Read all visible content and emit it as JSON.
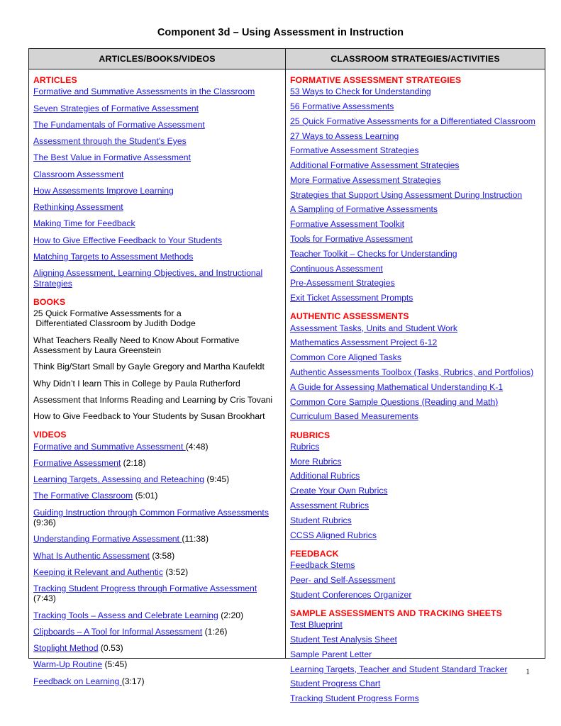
{
  "document": {
    "title": "Component 3d – Using Assessment in Instruction",
    "page_number": "1"
  },
  "colors": {
    "section_heading": "#FF0000",
    "link": "#1A14E6",
    "header_row_background": "#D4D4D4",
    "border": "#1A1A1A",
    "body_text": "#000000"
  },
  "table": {
    "headers": {
      "left": "ARTICLES/BOOKS/VIDEOS",
      "right": "CLASSROOM STRATEGIES/ACTIVITIES"
    },
    "left_column": {
      "sections": [
        {
          "heading": "ARTICLES",
          "type": "links",
          "items": [
            {
              "label": "Formative and Summative Assessments in the Classroom"
            },
            {
              "label": "Seven Strategies of Formative Assessment"
            },
            {
              "label": "The Fundamentals of Formative Assessment"
            },
            {
              "label": "Assessment through the Student's Eyes"
            },
            {
              "label": "The Best Value in Formative Assessment"
            },
            {
              "label": "Classroom Assessment"
            },
            {
              "label": "How Assessments Improve Learning"
            },
            {
              "label": "Rethinking Assessment"
            },
            {
              "label": "Making Time for Feedback"
            },
            {
              "label": "How to Give Effective Feedback to Your Students"
            },
            {
              "label": "Matching Targets to Assessment Methods"
            },
            {
              "label": "Aligning Assessment,  Learning Objectives, and Instructional Strategies"
            }
          ]
        },
        {
          "heading": "BOOKS",
          "type": "plain",
          "items": [
            {
              "label": "25 Quick Formative Assessments for a\n Differentiated Classroom by Judith Dodge"
            },
            {
              "label": "What Teachers Really Need to Know About Formative Assessment by Laura Greenstein"
            },
            {
              "label": "Think Big/Start Small by Gayle Gregory and Martha Kaufeldt"
            },
            {
              "label": "Why Didn’t I learn This in College by Paula Rutherford"
            },
            {
              "label": "Assessment that Informs Reading and Learning by Cris Tovani"
            },
            {
              "label": "How to Give Feedback to Your Students by Susan Brookhart"
            }
          ]
        },
        {
          "heading": "VIDEOS",
          "type": "links_with_duration",
          "items": [
            {
              "label": "Formative and Summative Assessment ",
              "duration": "(4:48)"
            },
            {
              "label": "Formative Assessment",
              "duration": "(2:18)"
            },
            {
              "label": "Learning Targets, Assessing and Reteaching",
              "duration": "(9:45)"
            },
            {
              "label": "The Formative Classroom",
              "duration": "(5:01)"
            },
            {
              "label": "Guiding Instruction through Common Formative Assessments",
              "duration": "(9:36)"
            },
            {
              "label": "Understanding Formative Assessment ",
              "duration": "(11:38)"
            },
            {
              "label": "What Is Authentic Assessment",
              "duration": "(3:58)"
            },
            {
              "label": "Keeping it Relevant and Authentic",
              "duration": "(3:52)"
            },
            {
              "label": "Tracking Student Progress through Formative Assessment",
              "duration": "(7:43)"
            },
            {
              "label": "Tracking Tools – Assess and Celebrate Learning",
              "duration": "(2:20)"
            },
            {
              "label": "Clipboards – A Tool for Informal Assessment",
              "duration": "(1:26)"
            },
            {
              "label": "Stoplight Method",
              "duration": "(0.53)"
            },
            {
              "label": "Warm-Up Routine",
              "duration": "(5:45)"
            },
            {
              "label": "Feedback on Learning ",
              "duration": "(3:17)"
            }
          ]
        }
      ]
    },
    "right_column": {
      "sections": [
        {
          "heading": "FORMATIVE ASSESSMENT STRATEGIES",
          "type": "links",
          "items": [
            {
              "label": "53 Ways to Check for Understanding"
            },
            {
              "label": "56 Formative Assessments"
            },
            {
              "label": "25 Quick Formative Assessments for a Differentiated Classroom"
            },
            {
              "label": "27 Ways to Assess Learning"
            },
            {
              "label": "Formative Assessment Strategies"
            },
            {
              "label": "Additional Formative Assessment Strategies"
            },
            {
              "label": "More Formative Assessment Strategies"
            },
            {
              "label": "Strategies that Support Using Assessment During Instruction"
            },
            {
              "label": "A Sampling of Formative Assessments"
            },
            {
              "label": "Formative Assessment Toolkit"
            },
            {
              "label": "Tools for Formative Assessment"
            },
            {
              "label": "Teacher Toolkit – Checks for Understanding"
            },
            {
              "label": "Continuous Assessment"
            },
            {
              "label": "Pre-Assessment Strategies"
            },
            {
              "label": "Exit Ticket Assessment Prompts"
            }
          ]
        },
        {
          "heading": "AUTHENTIC ASSESSMENTS",
          "type": "links",
          "items": [
            {
              "label": "Assessment Tasks, Units and Student Work"
            },
            {
              "label": "Mathematics Assessment Project 6-12"
            },
            {
              "label": "Common Core Aligned Tasks"
            },
            {
              "label": "Authentic Assessments Toolbox (Tasks, Rubrics, and Portfolios)"
            },
            {
              "label": "A Guide for Assessing Mathematical Understanding K-1"
            },
            {
              "label": "Common Core Sample Questions (Reading and Math)"
            },
            {
              "label": "Curriculum Based Measurements"
            }
          ]
        },
        {
          "heading": "RUBRICS",
          "type": "links",
          "items": [
            {
              "label": "Rubrics"
            },
            {
              "label": "More Rubrics"
            },
            {
              "label": "Additional Rubrics"
            },
            {
              "label": "Create Your Own Rubrics"
            },
            {
              "label": "Assessment Rubrics"
            },
            {
              "label": "Student Rubrics"
            },
            {
              "label": "CCSS Aligned Rubrics"
            }
          ]
        },
        {
          "heading": "FEEDBACK",
          "type": "links",
          "items": [
            {
              "label": "Feedback Stems"
            },
            {
              "label": "Peer- and Self-Assessment"
            },
            {
              "label": "Student Conferences Organizer"
            }
          ]
        },
        {
          "heading": "SAMPLE ASSESSMENTS AND TRACKING SHEETS",
          "type": "links",
          "items": [
            {
              "label": "Test Blueprint"
            },
            {
              "label": "Student Test Analysis Sheet"
            },
            {
              "label": "Sample Parent Letter"
            },
            {
              "label": "Learning Targets,  Teacher and Student Standard Tracker"
            },
            {
              "label": "Student Progress Chart"
            },
            {
              "label": "Tracking Student Progress Forms"
            }
          ]
        }
      ]
    }
  }
}
